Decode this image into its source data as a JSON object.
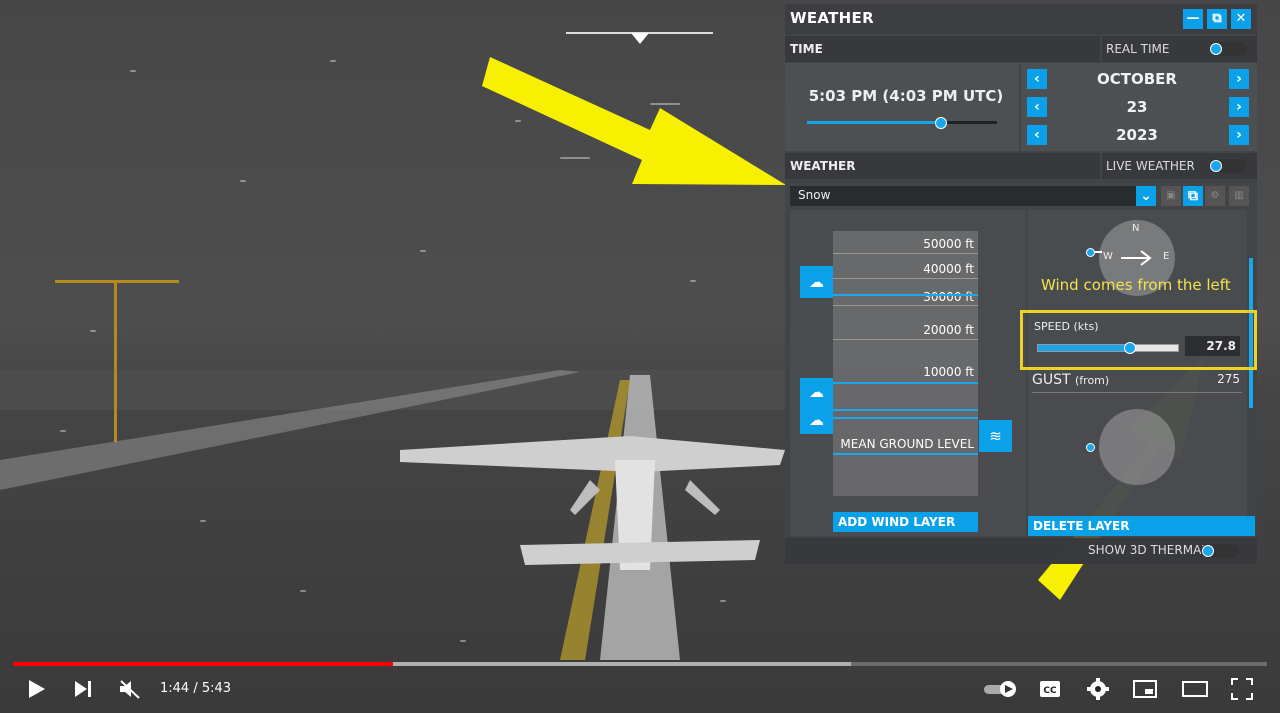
{
  "window": {
    "title": "WEATHER"
  },
  "time_section": {
    "label": "TIME",
    "real_time_label": "REAL TIME",
    "time_display": "5:03 PM (4:03 PM UTC)",
    "time_slider_fraction": 0.72,
    "month": "OCTOBER",
    "day": "23",
    "year": "2023"
  },
  "weather_section": {
    "label": "WEATHER",
    "live_weather_label": "LIVE WEATHER",
    "preset": "Snow"
  },
  "altitudes": [
    "50000 ft",
    "40000 ft",
    "30000 ft",
    "20000 ft",
    "10000 ft"
  ],
  "ground_label": "MEAN GROUND LEVEL",
  "add_wind_layer": "ADD WIND LAYER",
  "compass": {
    "n": "N",
    "w": "W",
    "e": "E"
  },
  "wind": {
    "speed_label": "SPEED (kts)",
    "speed_value": "27.8",
    "speed_fraction": 0.66,
    "gust_label": "GUST",
    "gust_suffix": "(from)",
    "gust_value": "275"
  },
  "delete_layer": "DELETE LAYER",
  "thermal_label": "SHOW 3D THERMAL",
  "annotation": "Wind comes from the left",
  "player": {
    "time": "1:44 / 5:43",
    "progress_fraction": 0.303,
    "buffer_fraction": 0.668
  },
  "icons": [
    "play-icon",
    "next-icon",
    "mute-icon",
    "autoplay-icon",
    "cc-icon",
    "settings-icon",
    "miniplayer-icon",
    "theater-icon",
    "fullscreen-icon"
  ],
  "colors": {
    "accent": "#0aa1e8",
    "annotation": "#f0d12a",
    "progress": "#ff0000"
  }
}
